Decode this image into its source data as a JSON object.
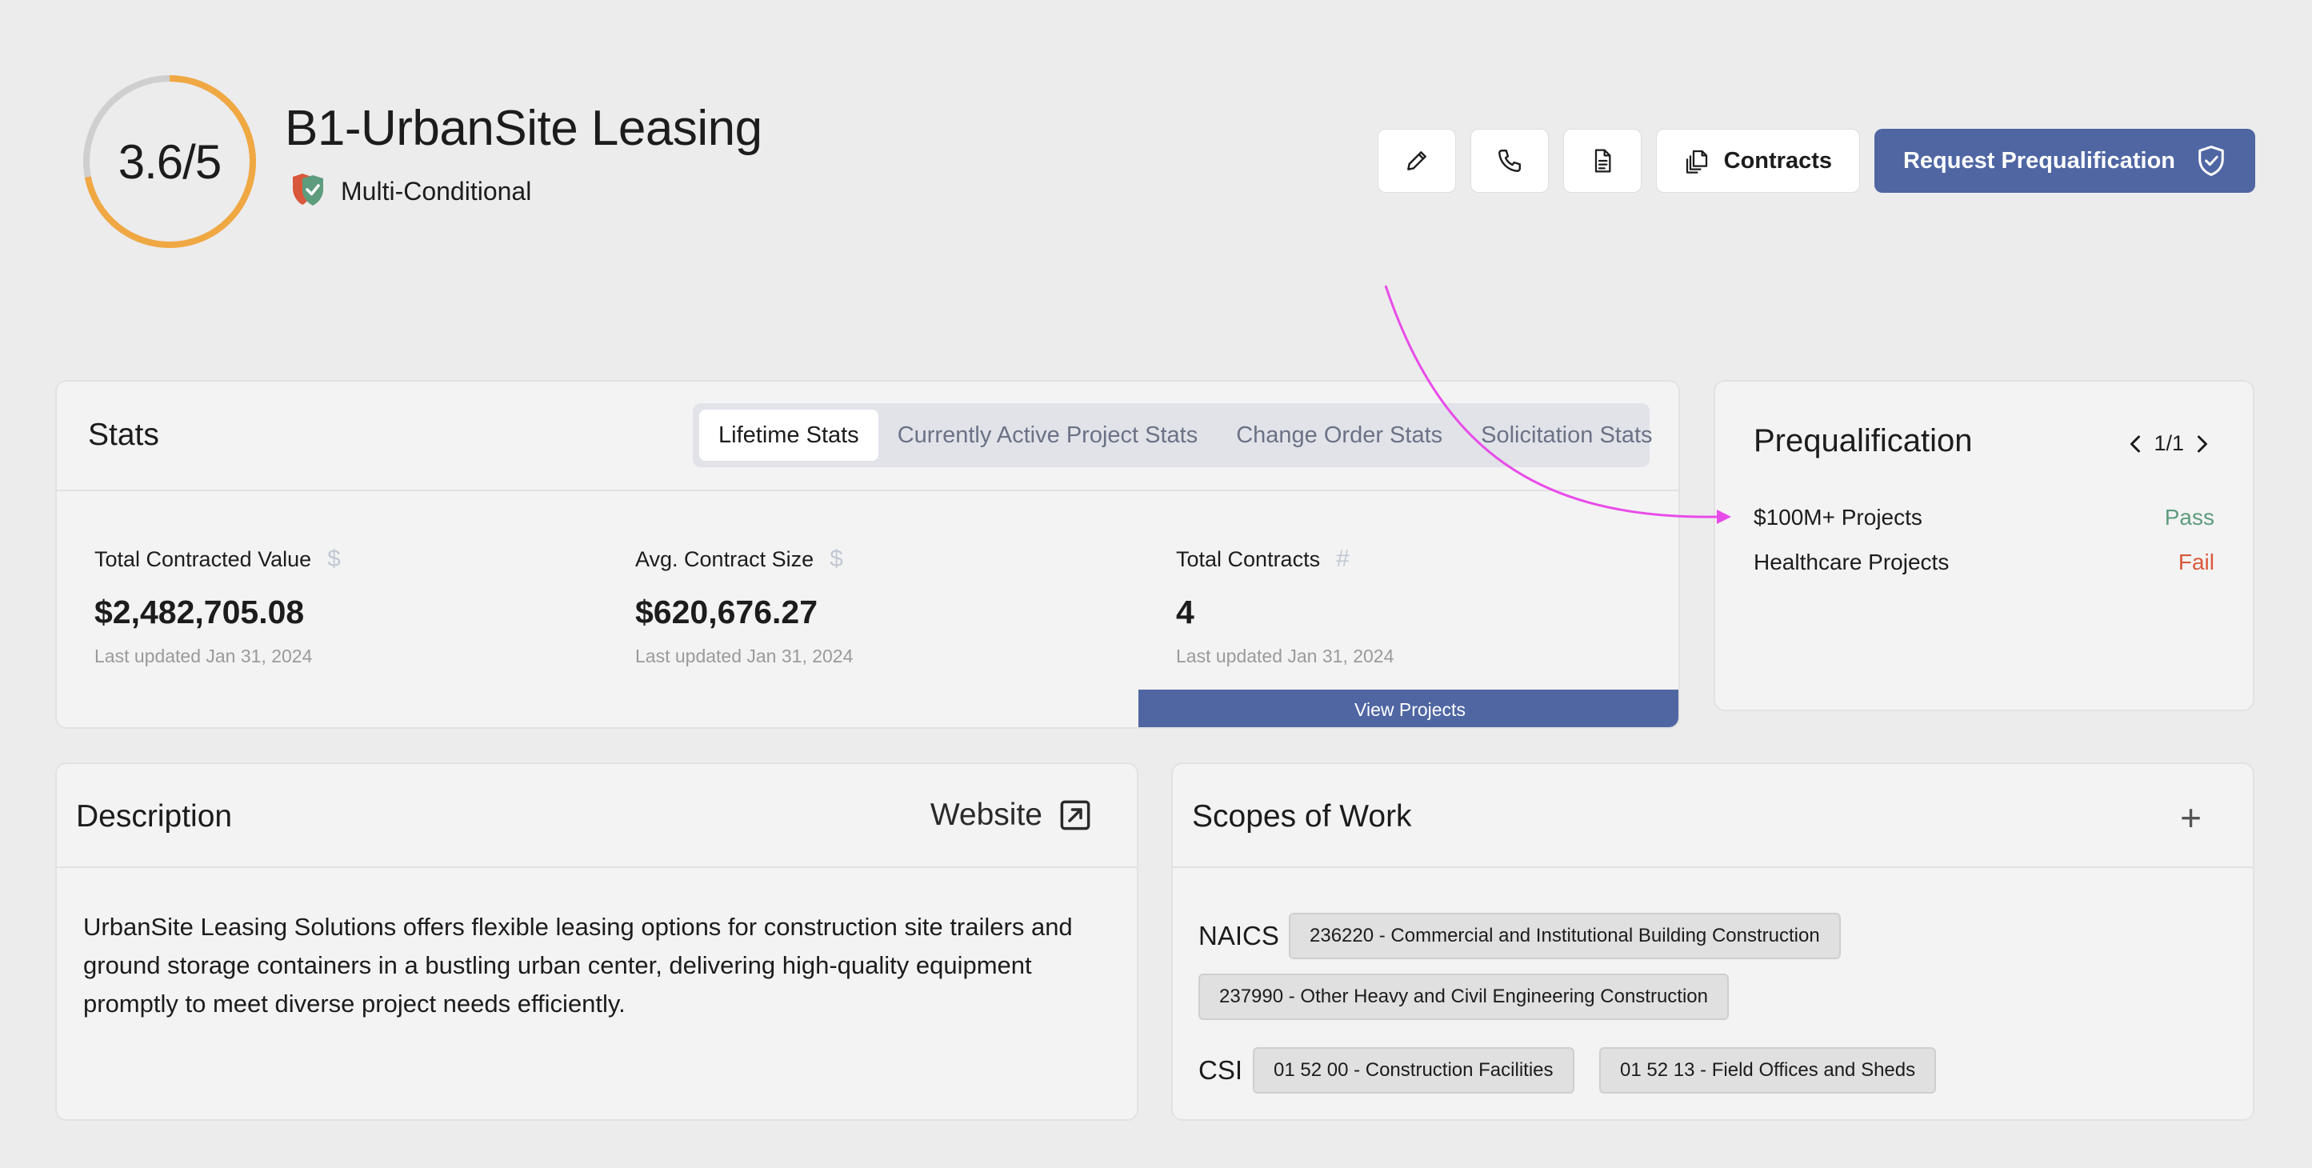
{
  "header": {
    "rating": "3.6/5",
    "rating_fraction": 0.72,
    "company_name": "B1-UrbanSite Leasing",
    "status_label": "Multi-Conditional"
  },
  "actions": {
    "edit_icon": "pencil-icon",
    "phone_icon": "phone-icon",
    "document_icon": "document-icon",
    "contracts_label": "Contracts",
    "request_label": "Request Prequalification"
  },
  "stats": {
    "title": "Stats",
    "tabs": [
      {
        "label": "Lifetime Stats",
        "active": true
      },
      {
        "label": "Currently Active Project Stats",
        "active": false
      },
      {
        "label": "Change Order Stats",
        "active": false
      },
      {
        "label": "Solicitation Stats",
        "active": false
      }
    ],
    "items": [
      {
        "label": "Total Contracted Value",
        "icon": "$",
        "value": "$2,482,705.08",
        "updated": "Last updated Jan 31, 2024"
      },
      {
        "label": "Avg. Contract Size",
        "icon": "$",
        "value": "$620,676.27",
        "updated": "Last updated Jan 31, 2024"
      },
      {
        "label": "Total Contracts",
        "icon": "#",
        "value": "4",
        "updated": "Last updated Jan 31, 2024"
      }
    ],
    "view_projects": "View Projects"
  },
  "prequalification": {
    "title": "Prequalification",
    "pager": "1/1",
    "rows": [
      {
        "name": "$100M+ Projects",
        "result": "Pass"
      },
      {
        "name": "Healthcare Projects",
        "result": "Fail"
      }
    ]
  },
  "description": {
    "title": "Description",
    "website_label": "Website",
    "text": "UrbanSite Leasing Solutions offers flexible leasing options for construction site trailers and ground storage containers in a bustling urban center, delivering high-quality equipment promptly to meet diverse project needs efficiently."
  },
  "scopes": {
    "title": "Scopes of Work",
    "add_label": "+",
    "naics_label": "NAICS",
    "naics": [
      "236220 - Commercial and Institutional Building Construction",
      "237990 - Other Heavy and Civil Engineering Construction"
    ],
    "csi_label": "CSI",
    "csi": [
      "01 52 00 - Construction Facilities",
      "01 52 13 - Field Offices and Sheds"
    ]
  },
  "colors": {
    "accent": "#4f66a3",
    "rating_ring": "#f0a843",
    "pass": "#5e9c7e",
    "fail": "#d9583b",
    "annotation_arrow": "#e84ce8"
  }
}
